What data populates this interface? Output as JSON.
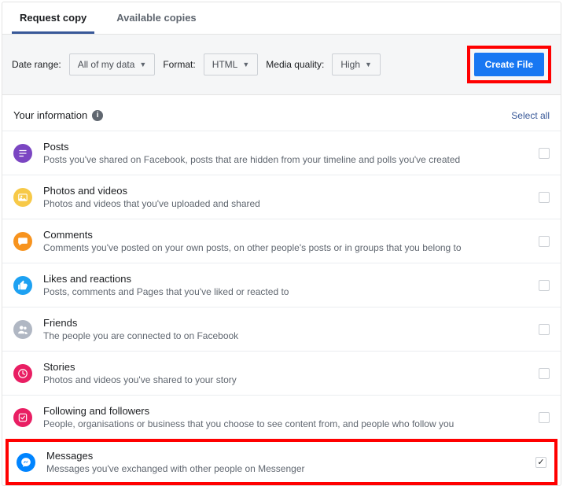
{
  "tabs": {
    "request": "Request copy",
    "available": "Available copies"
  },
  "filters": {
    "date_label": "Date range:",
    "date_value": "All of my data",
    "format_label": "Format:",
    "format_value": "HTML",
    "quality_label": "Media quality:",
    "quality_value": "High"
  },
  "create_button": "Create File",
  "section": {
    "title": "Your information",
    "select_all": "Select all"
  },
  "items": [
    {
      "title": "Posts",
      "desc": "Posts you've shared on Facebook, posts that are hidden from your timeline and polls you've created",
      "color": "#7b46c2",
      "icon": "posts",
      "checked": false
    },
    {
      "title": "Photos and videos",
      "desc": "Photos and videos that you've uploaded and shared",
      "color": "#f7c948",
      "icon": "photos",
      "checked": false
    },
    {
      "title": "Comments",
      "desc": "Comments you've posted on your own posts, on other people's posts or in groups that you belong to",
      "color": "#f7931e",
      "icon": "comments",
      "checked": false
    },
    {
      "title": "Likes and reactions",
      "desc": "Posts, comments and Pages that you've liked or reacted to",
      "color": "#1da1f2",
      "icon": "likes",
      "checked": false
    },
    {
      "title": "Friends",
      "desc": "The people you are connected to on Facebook",
      "color": "#b0b7c3",
      "icon": "friends",
      "checked": false
    },
    {
      "title": "Stories",
      "desc": "Photos and videos you've shared to your story",
      "color": "#e91e63",
      "icon": "stories",
      "checked": false
    },
    {
      "title": "Following and followers",
      "desc": "People, organisations or business that you choose to see content from, and people who follow you",
      "color": "#e91e63",
      "icon": "following",
      "checked": false
    },
    {
      "title": "Messages",
      "desc": "Messages you've exchanged with other people on Messenger",
      "color": "#0084ff",
      "icon": "messages",
      "checked": true,
      "highlight": true
    }
  ]
}
